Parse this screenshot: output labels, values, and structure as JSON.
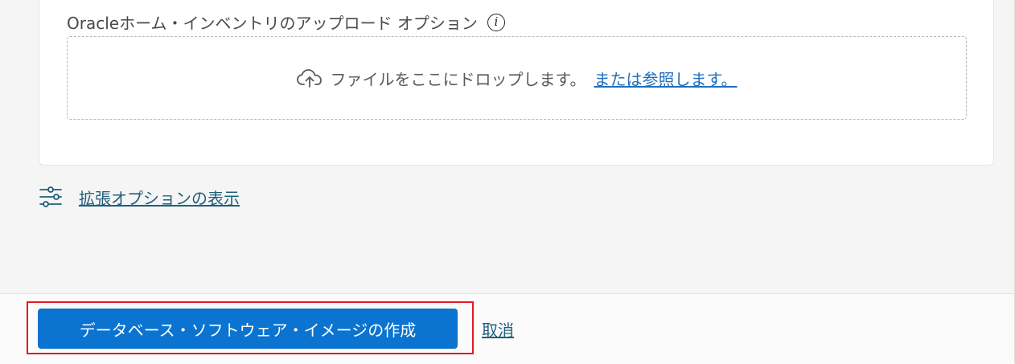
{
  "upload": {
    "label": "Oracleホーム・インベントリのアップロード オプション",
    "info_icon": "info-icon",
    "dropzone": {
      "icon": "cloud-upload-icon",
      "text": "ファイルをここにドロップします。",
      "browse_link": "または参照します。"
    }
  },
  "advanced": {
    "icon": "sliders-icon",
    "label": "拡張オプションの表示"
  },
  "footer": {
    "primary_button": "データベース・ソフトウェア・イメージの作成",
    "cancel_link": "取消"
  },
  "colors": {
    "primary": "#0b73d0",
    "link": "#1f6fbf",
    "advanced_link": "#1f5f7a",
    "highlight": "#e31b23",
    "page_background": "#f5f5f5"
  }
}
